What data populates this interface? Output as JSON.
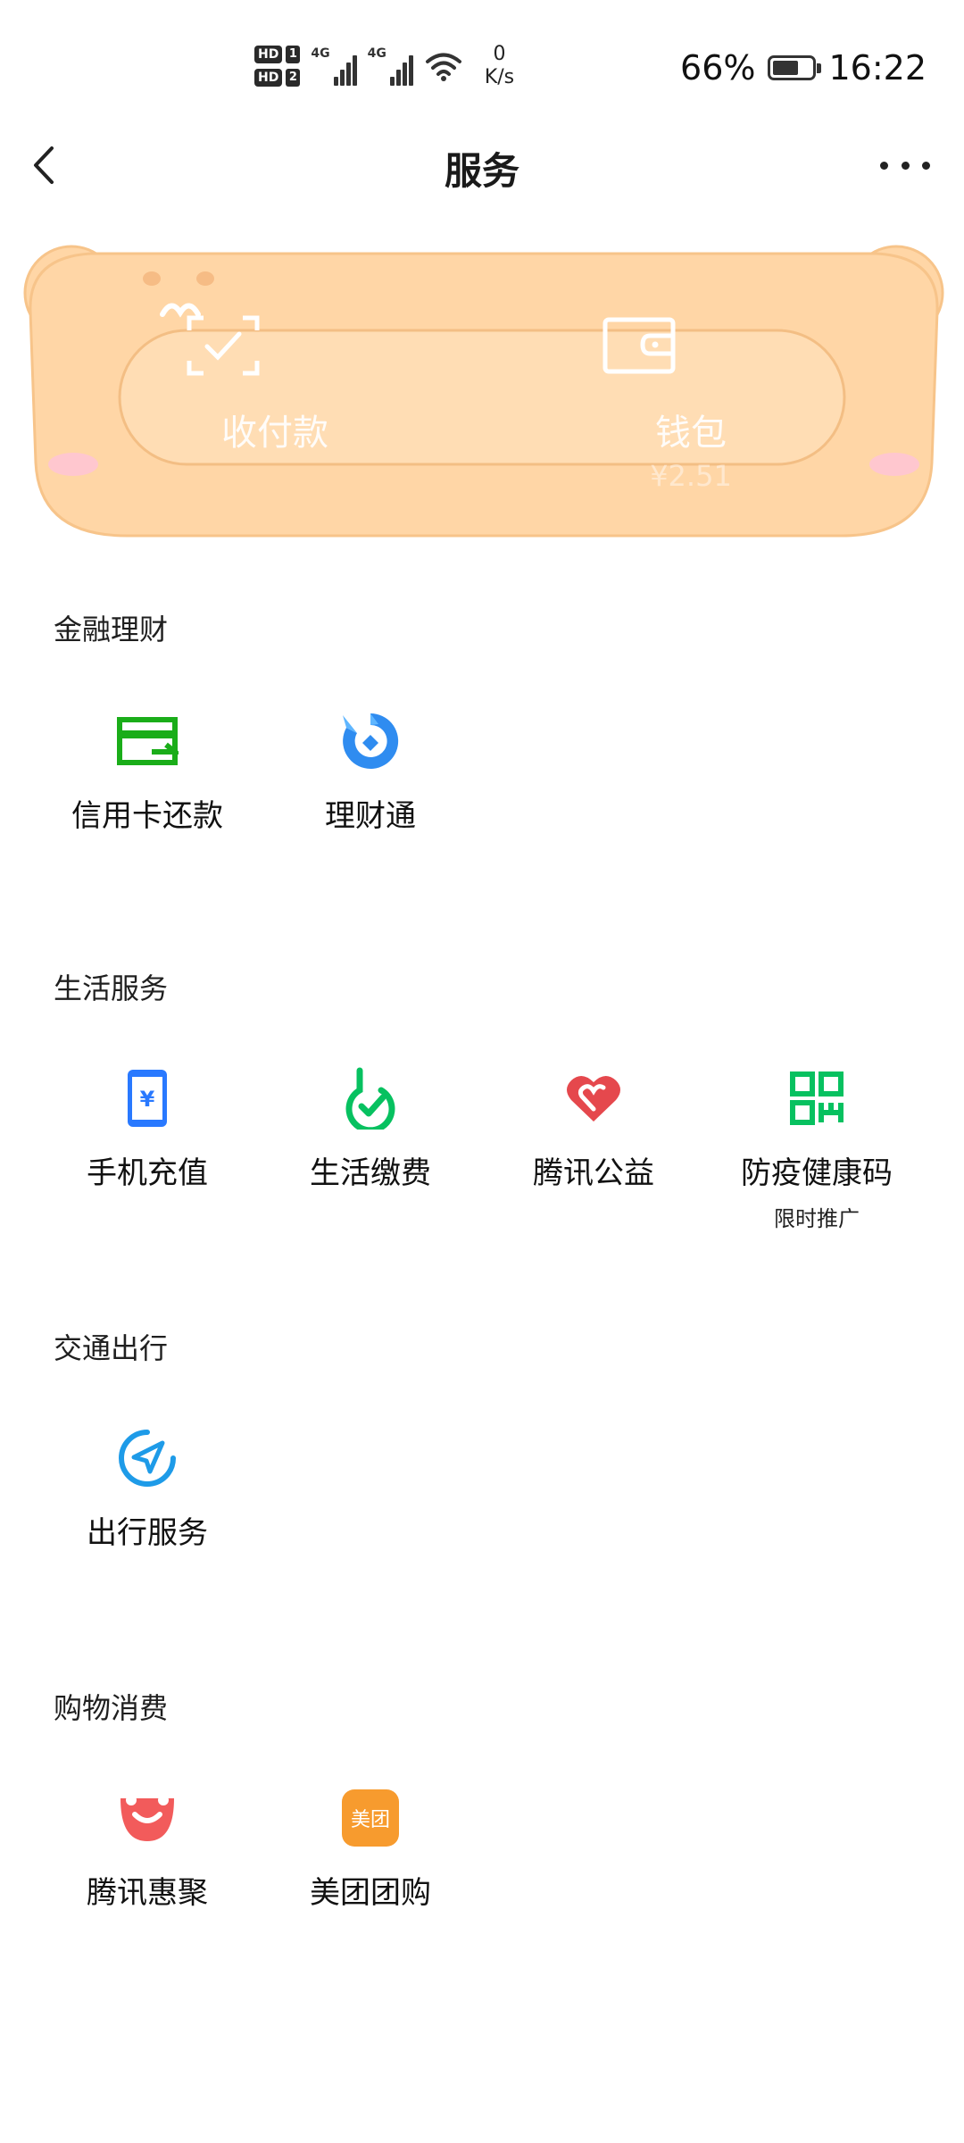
{
  "status_bar": {
    "sim1": "HD",
    "sim1_num": "1",
    "sim2": "HD",
    "sim2_num": "2",
    "net_type_1": "4G",
    "net_type_2": "4G",
    "speed_value": "0",
    "speed_unit": "K/s",
    "battery_percent_label": "66%",
    "battery_level": 0.66,
    "time": "16:22"
  },
  "header": {
    "title": "服务"
  },
  "banner": {
    "items": [
      {
        "label": "收付款",
        "icon": "scan-pay-icon"
      },
      {
        "label": "钱包",
        "sub": "¥2.51",
        "icon": "wallet-icon"
      }
    ]
  },
  "sections": [
    {
      "title": "金融理财",
      "items": [
        {
          "label": "信用卡还款",
          "icon": "credit-card-icon",
          "color": "#1AAD19"
        },
        {
          "label": "理财通",
          "icon": "wealth-icon",
          "color": "#1E88E5"
        }
      ]
    },
    {
      "title": "生活服务",
      "items": [
        {
          "label": "手机充值",
          "icon": "phone-recharge-icon",
          "color": "#2979FF"
        },
        {
          "label": "生活缴费",
          "icon": "utility-bill-icon",
          "color": "#07C160"
        },
        {
          "label": "腾讯公益",
          "icon": "charity-heart-icon",
          "color": "#E5484D"
        },
        {
          "label": "防疫健康码",
          "sub": "限时推广",
          "icon": "health-code-icon",
          "color": "#07C160"
        }
      ]
    },
    {
      "title": "交通出行",
      "items": [
        {
          "label": "出行服务",
          "icon": "travel-compass-icon",
          "color": "#1E9BE8"
        }
      ]
    },
    {
      "title": "购物消费",
      "items": [
        {
          "label": "腾讯惠聚",
          "icon": "shopping-smile-icon",
          "color": "#F25B5B"
        },
        {
          "label": "美团团购",
          "icon": "meituan-icon",
          "color": "#F79B2E",
          "icon_text": "美团"
        }
      ]
    }
  ]
}
